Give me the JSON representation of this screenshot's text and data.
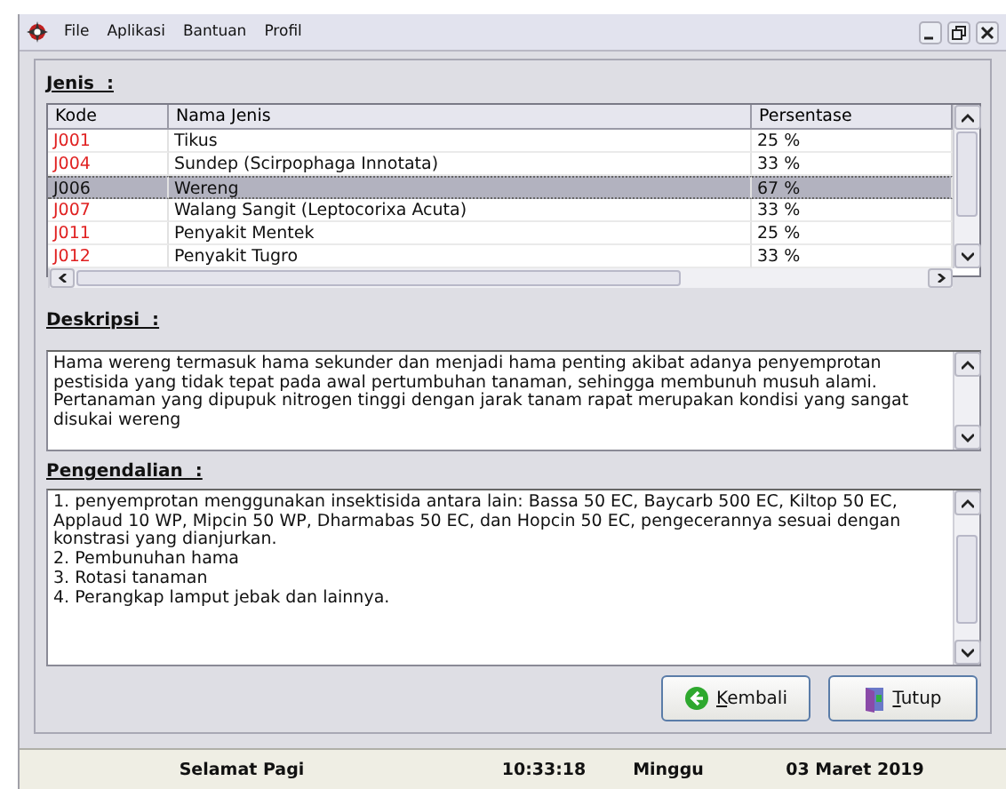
{
  "window": {
    "menu": [
      "File",
      "Aplikasi",
      "Bantuan",
      "Profil"
    ]
  },
  "jenis": {
    "label": "Jenis  :",
    "columns": [
      "Kode",
      "Nama Jenis",
      "Persentase"
    ],
    "rows": [
      {
        "cells": [
          "J001",
          "Tikus",
          "25 %"
        ],
        "selected": false
      },
      {
        "cells": [
          "J004",
          "Sundep (Scirpophaga Innotata)",
          "33 %"
        ],
        "selected": false
      },
      {
        "cells": [
          "J006",
          "Wereng",
          "67 %"
        ],
        "selected": true
      },
      {
        "cells": [
          "J007",
          "Walang Sangit (Leptocorixa Acuta)",
          "33 %"
        ],
        "selected": false
      },
      {
        "cells": [
          "J011",
          "Penyakit Mentek",
          "25 %"
        ],
        "selected": false
      },
      {
        "cells": [
          "J012",
          "Penyakit Tugro",
          "33 %"
        ],
        "selected": false
      }
    ]
  },
  "deskripsi": {
    "label": "Deskripsi  :",
    "text": "Hama wereng termasuk hama sekunder dan menjadi hama penting akibat adanya penyemprotan pestisida yang tidak tepat pada awal pertumbuhan tanaman, sehingga membunuh musuh alami. Pertanaman yang dipupuk nitrogen tinggi dengan jarak tanam rapat merupakan kondisi yang sangat disukai wereng"
  },
  "pengendalian": {
    "label": "Pengendalian  :",
    "lines": [
      "1. penyemprotan menggunakan insektisida antara lain: Bassa 50 EC, Baycarb 500 EC, Kiltop 50 EC, Applaud 10 WP, Mipcin 50 WP, Dharmabas 50 EC, dan Hopcin 50 EC, pengecerannya sesuai dengan konstrasi yang dianjurkan.",
      "2. Pembunuhan hama",
      "3. Rotasi tanaman",
      "4. Perangkap lamput jebak dan lainnya."
    ]
  },
  "buttons": [
    {
      "label": "Kembali",
      "kind": "back"
    },
    {
      "label": "Tutup",
      "kind": "exit"
    }
  ],
  "status_bar": [
    "Selamat Pagi",
    "10:33:18",
    "Minggu",
    "03 Maret 2019"
  ]
}
